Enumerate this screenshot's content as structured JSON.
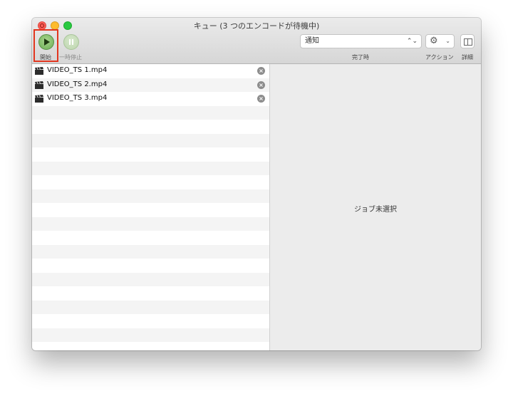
{
  "window": {
    "title": "キュー (3 つのエンコードが待機中)"
  },
  "toolbar": {
    "start_label": "開始",
    "pause_label": "一時停止",
    "notification_select": "通知",
    "completion_label": "完了時",
    "action_label": "アクション",
    "detail_label": "詳細"
  },
  "queue": {
    "items": [
      {
        "name": "VIDEO_TS 1.mp4"
      },
      {
        "name": "VIDEO_TS 2.mp4"
      },
      {
        "name": "VIDEO_TS 3.mp4"
      }
    ]
  },
  "detail": {
    "empty_message": "ジョブ未選択"
  },
  "colors": {
    "start_green": "#6bae55",
    "highlight_red": "#e2361f",
    "close_red": "#fc5f57",
    "minimize_yellow": "#fdbc2e",
    "maximize_green": "#28c940"
  },
  "icons": {
    "start": "play-icon",
    "pause": "pause-icon",
    "action": "gear-icon",
    "detail": "sidebar-toggle-icon",
    "item": "clapperboard-icon",
    "remove": "remove-circle-icon"
  }
}
